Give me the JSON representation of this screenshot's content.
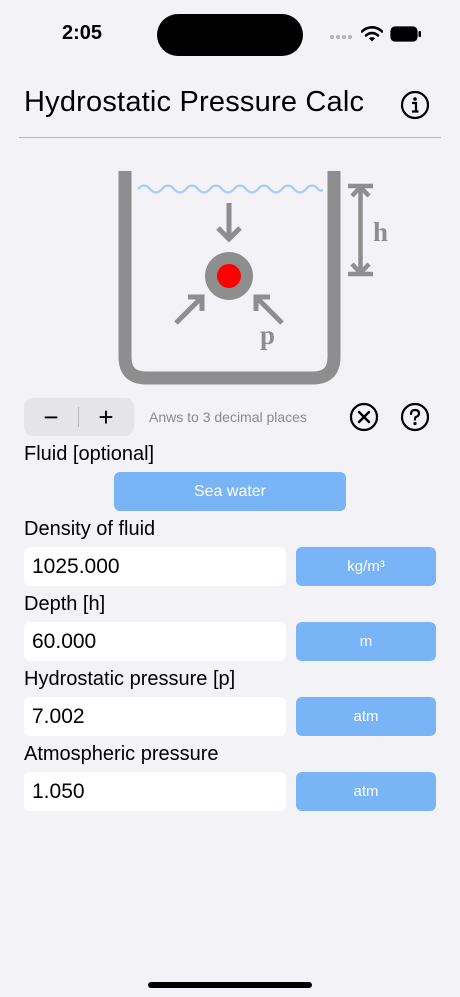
{
  "status_bar": {
    "time": "2:05"
  },
  "header": {
    "title": "Hydrostatic Pressure Calc"
  },
  "diagram": {
    "depth_label": "h",
    "pressure_label": "p"
  },
  "controls": {
    "minus_label": "−",
    "plus_label": "+",
    "decimals_text": "Anws to 3 decimal places"
  },
  "fluid": {
    "label": "Fluid [optional]",
    "button_label": "Sea water"
  },
  "density": {
    "label": "Density of fluid",
    "value": "1025.000",
    "unit": "kg/m³"
  },
  "depth": {
    "label": "Depth [h]",
    "value": "60.000",
    "unit": "m"
  },
  "hydrostatic_pressure": {
    "label": "Hydrostatic pressure [p]",
    "value": "7.002",
    "unit": "atm"
  },
  "atmospheric_pressure": {
    "label": "Atmospheric pressure",
    "value": "1.050",
    "unit": "atm"
  },
  "colors": {
    "accent": "#79b4f6",
    "background": "#f2f2f7",
    "vessel": "#8e8e8e",
    "water_line": "#a9cdf5",
    "ball_outer": "#8e8e8e",
    "ball_inner": "#ff0000"
  }
}
